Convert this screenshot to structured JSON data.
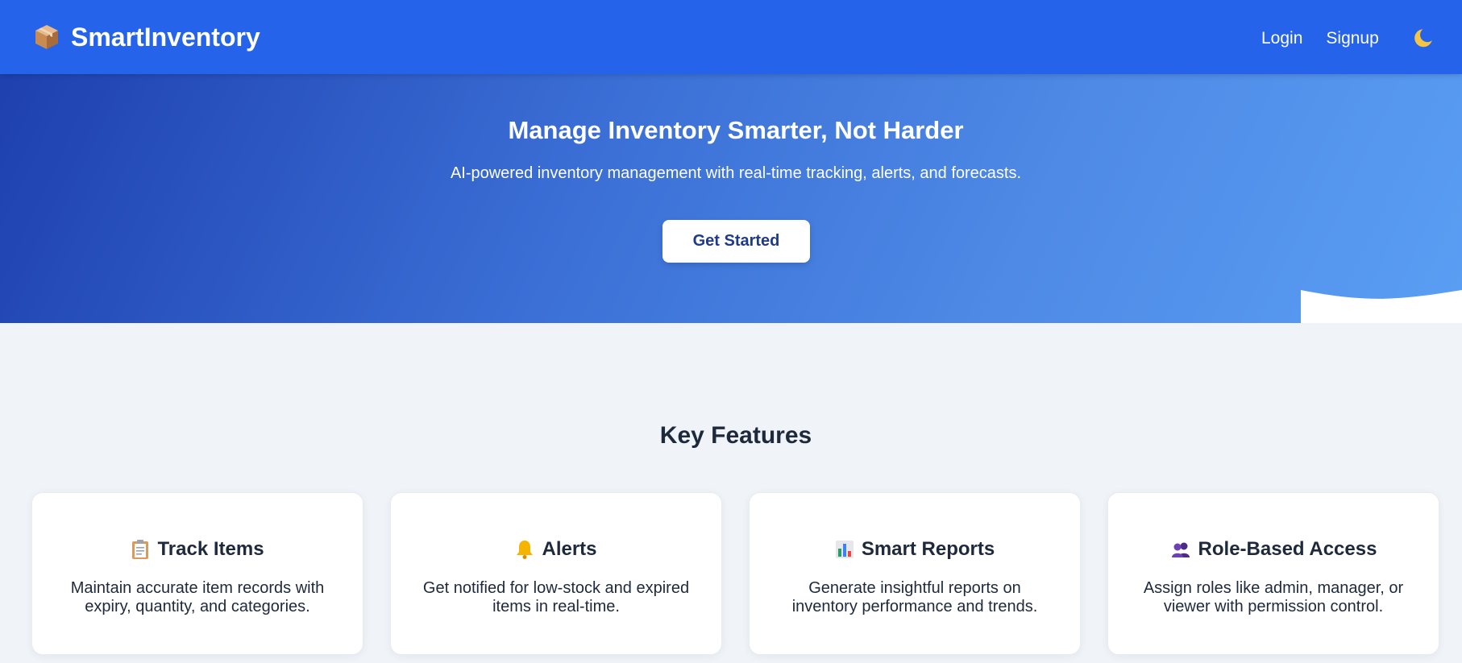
{
  "navbar": {
    "brand_name": "SmartInventory",
    "brand_icon": "package-icon",
    "links": {
      "login": "Login",
      "signup": "Signup"
    },
    "theme_toggle_icon": "moon-icon",
    "bg_color": "#2563eb"
  },
  "hero": {
    "title": "Manage Inventory Smarter, Not Harder",
    "subtitle": "AI-powered inventory management with real-time tracking, alerts, and forecasts.",
    "cta_label": "Get Started",
    "gradient": [
      "#1e40af",
      "#5a9ef4"
    ]
  },
  "features": {
    "title": "Key Features",
    "items": [
      {
        "icon": "clipboard-icon",
        "title": "Track Items",
        "description": "Maintain accurate item records with expiry, quantity, and categories."
      },
      {
        "icon": "bell-icon",
        "title": "Alerts",
        "description": "Get notified for low-stock and expired items in real-time."
      },
      {
        "icon": "bar-chart-icon",
        "title": "Smart Reports",
        "description": "Generate insightful reports on inventory performance and trends."
      },
      {
        "icon": "users-icon",
        "title": "Role-Based Access",
        "description": "Assign roles like admin, manager, or viewer with permission control."
      }
    ]
  }
}
